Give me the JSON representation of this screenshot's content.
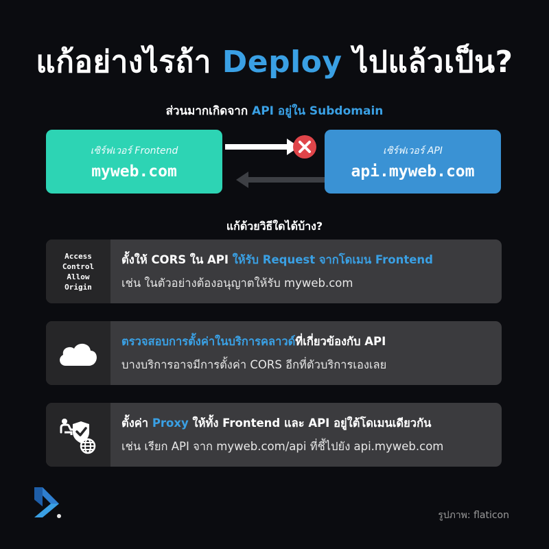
{
  "title": {
    "prefix": "แก้อย่างไรถ้า ",
    "accent": "Deploy",
    "suffix": " ไปแล้วเป็น?"
  },
  "subtitle": {
    "prefix": "ส่วนมากเกิดจาก ",
    "accent": "API อยู่ใน Subdomain"
  },
  "servers": {
    "frontend": {
      "caption": "เซิร์ฟเวอร์ Frontend",
      "host": "myweb.com",
      "color": "#2dd4b4"
    },
    "api": {
      "caption": "เซิร์ฟเวอร์ API",
      "host": "api.myweb.com",
      "color": "#3a92d4"
    }
  },
  "question": "แก้ด้วยวิธีใดได้บ้าง?",
  "solutions": [
    {
      "icon_text": "Access\nControl\nAllow\nOrigin",
      "line1_a": "ตั้งให้ CORS ใน API ",
      "line1_accent": "ให้รับ Request จากโดเมน Frontend",
      "line1_b": "",
      "line2": "เช่น ในตัวอย่างต้องอนุญาตให้รับ myweb.com"
    },
    {
      "icon": "cloud-icon",
      "line1_a": "",
      "line1_accent": "ตรวจสอบการตั้งค่าในบริการคลาวด์",
      "line1_b": "ที่เกี่ยวข้องกับ API",
      "line2": "บางบริการอาจมีการตั้งค่า CORS อีกที่ตัวบริการเองเลย"
    },
    {
      "icon": "proxy-icon",
      "line1_a": "ตั้งค่า ",
      "line1_accent": "Proxy",
      "line1_b": " ให้ทั้ง Frontend และ API อยู่ใต้โดเมนเดียวกัน",
      "line2": "เช่น เรียก API จาก myweb.com/api ที่ชี้ไปยัง api.myweb.com"
    }
  ],
  "credit": "รูปภาพ: flaticon",
  "colors": {
    "accent": "#3aa0e4",
    "card_bg": "#3b3b3e",
    "icon_cell_bg": "#262628",
    "error": "#e0454a"
  }
}
